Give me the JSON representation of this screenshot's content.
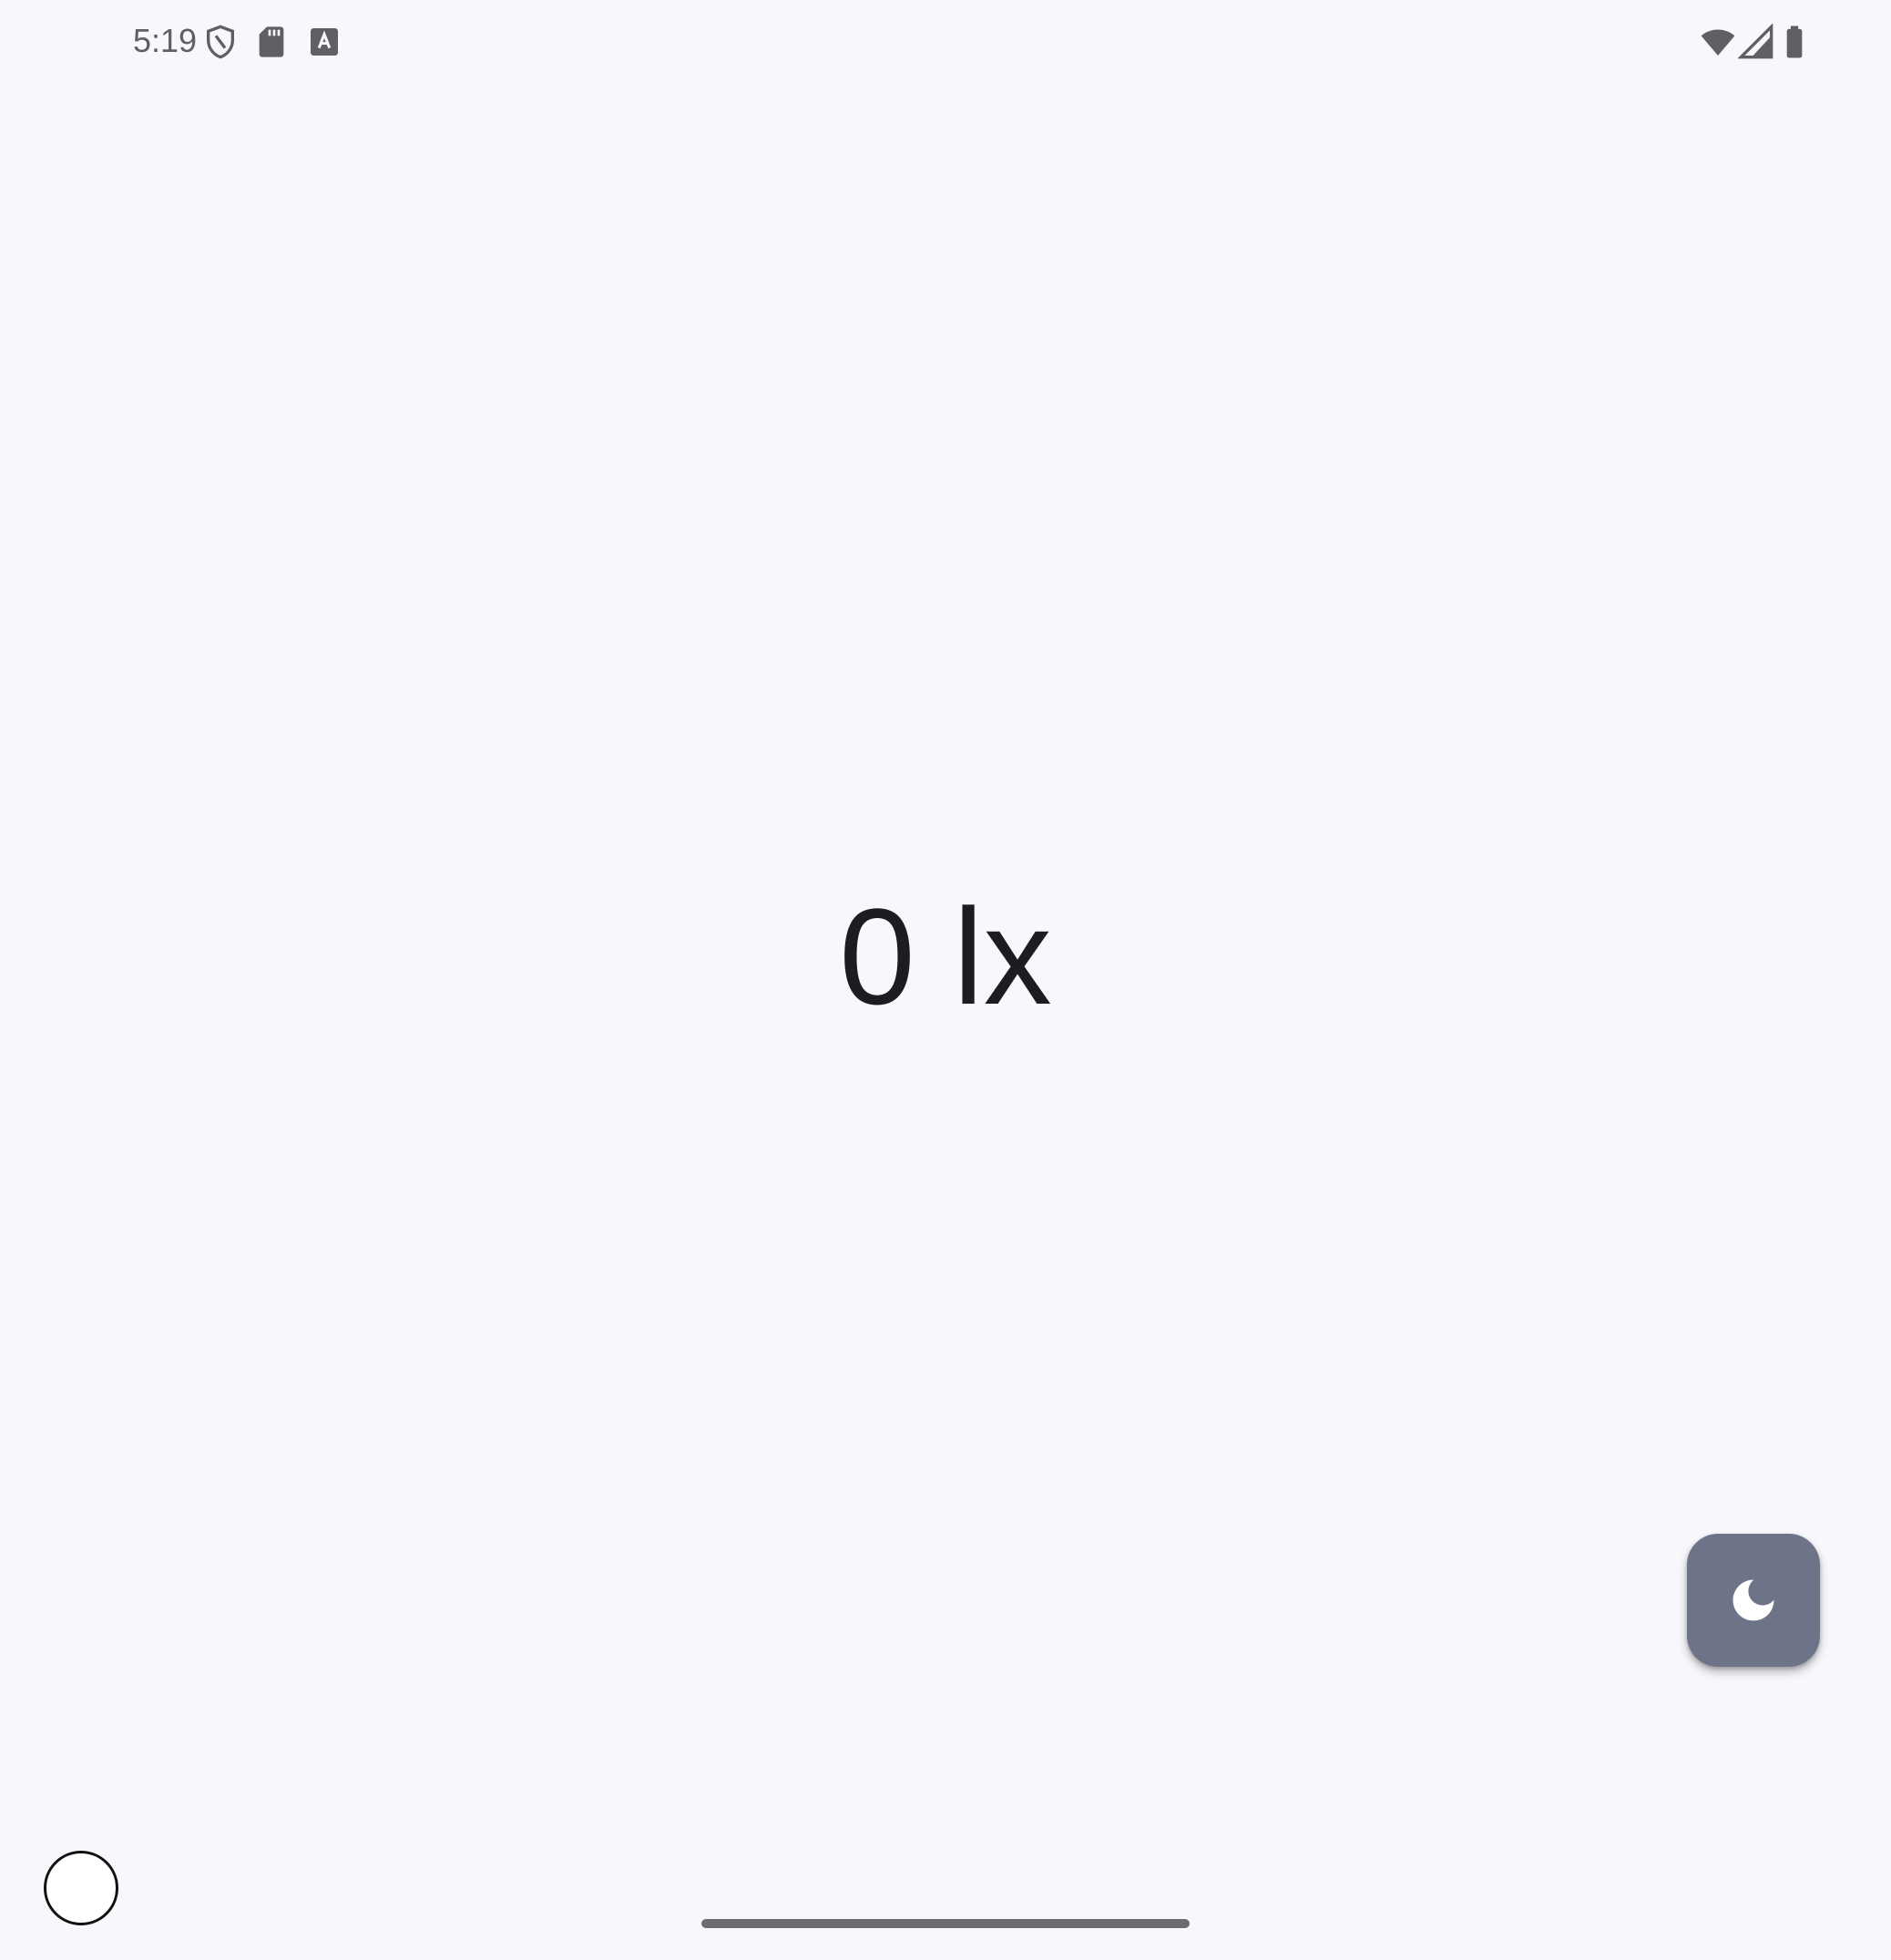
{
  "status_bar": {
    "time": "5:19",
    "left_icons": [
      "shield-icon",
      "sd-card-icon",
      "keyboard-a-icon"
    ],
    "right_icons": [
      "wifi-icon",
      "cell-signal-icon",
      "battery-icon"
    ]
  },
  "main": {
    "lux_value": "0 lx"
  },
  "fab": {
    "icon": "moon-icon"
  },
  "colors": {
    "background": "#f7f7fc",
    "text": "#1c1c21",
    "fab": "#6e7488",
    "status_icons": "#5f6066"
  }
}
